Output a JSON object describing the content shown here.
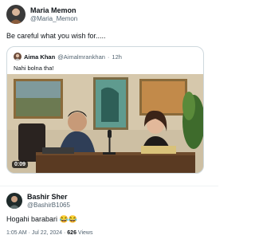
{
  "post": {
    "author_name": "Maria Memon",
    "author_handle": "@Maria_Memon",
    "text": "Be careful what you wish for.....",
    "avatar_icon": "avatar-photo"
  },
  "quoted_post": {
    "author_name": "Aima Khan",
    "author_handle": "@Aimalmrankhan",
    "separator": "·",
    "time": "12h",
    "text": "Nahi bolna tha!",
    "video_duration": "0:09",
    "video_icon": "video-thumbnail"
  },
  "reply": {
    "author_name": "Bashir Sher",
    "author_handle": "@BashirB1065",
    "text": "Hogahi barabari 😂😂",
    "time": "1:05 AM · Jul 22, 2024 ·",
    "views_count": "626",
    "views_label": "Views",
    "avatar_icon": "avatar-photo"
  },
  "colors": {
    "text_primary": "#0f1419",
    "text_secondary": "#536471",
    "border": "#cfd9de"
  }
}
